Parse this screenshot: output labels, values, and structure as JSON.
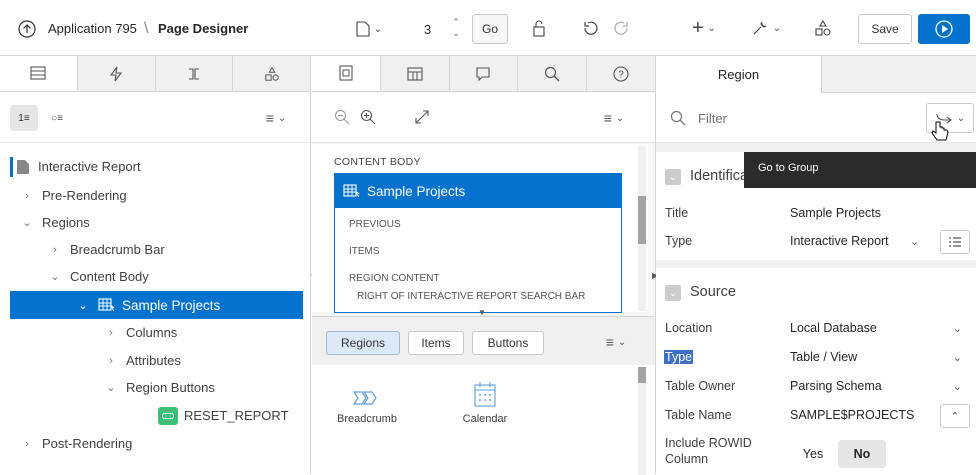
{
  "header": {
    "app_name": "Application 795",
    "separator": "\\",
    "page_designer": "Page Designer",
    "page_number": "3",
    "go_label": "Go",
    "save_label": "Save"
  },
  "left_pane": {
    "tree": [
      {
        "label": "Interactive Report",
        "icon": "page-icon",
        "level": 0
      },
      {
        "label": "Pre-Rendering",
        "level": 0,
        "expanded": false
      },
      {
        "label": "Regions",
        "level": 0,
        "expanded": true
      },
      {
        "label": "Breadcrumb Bar",
        "level": 1,
        "expanded": false
      },
      {
        "label": "Content Body",
        "level": 1,
        "expanded": true
      },
      {
        "label": "Sample Projects",
        "level": 2,
        "expanded": true,
        "selected": true,
        "icon": "interactive-report-icon"
      },
      {
        "label": "Columns",
        "level": 3,
        "expanded": false
      },
      {
        "label": "Attributes",
        "level": 3,
        "expanded": false
      },
      {
        "label": "Region Buttons",
        "level": 3,
        "expanded": true
      },
      {
        "label": "RESET_REPORT",
        "level": 4,
        "icon": "button-icon"
      },
      {
        "label": "Post-Rendering",
        "level": 0,
        "expanded": false
      }
    ]
  },
  "middle_pane": {
    "content_body_label": "CONTENT BODY",
    "region_title": "Sample Projects",
    "positions": [
      "PREVIOUS",
      "ITEMS",
      "REGION CONTENT",
      "RIGHT OF INTERACTIVE REPORT SEARCH BAR"
    ],
    "gallery_tabs": [
      "Regions",
      "Items",
      "Buttons"
    ],
    "gallery_items": [
      "Breadcrumb",
      "Calendar"
    ]
  },
  "right_pane": {
    "tab_label": "Region",
    "filter_placeholder": "Filter",
    "tooltip": "Go to Group",
    "identification": {
      "heading": "Identification",
      "title_label": "Title",
      "title_value": "Sample Projects",
      "type_label": "Type",
      "type_value": "Interactive Report"
    },
    "source": {
      "heading": "Source",
      "location_label": "Location",
      "location_value": "Local Database",
      "type_label": "Type",
      "type_value": "Table / View",
      "table_owner_label": "Table Owner",
      "table_owner_value": "Parsing Schema",
      "table_name_label": "Table Name",
      "table_name_value": "SAMPLE$PROJECTS",
      "rowid_label_1": "Include ROWID",
      "rowid_label_2": "Column",
      "yes_label": "Yes",
      "no_label": "No"
    }
  },
  "colors": {
    "accent": "#0572ce",
    "selected_row": "#0572ce",
    "button_green": "#3dbe7b"
  }
}
